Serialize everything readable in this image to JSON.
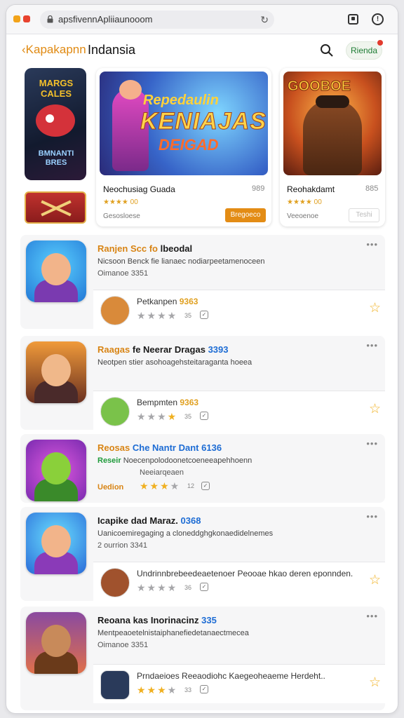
{
  "browser": {
    "address": "apsfivennApliiaunooom",
    "window_dot_colors": [
      "#f2a31a",
      "#e8432f"
    ]
  },
  "header": {
    "back_label": "Kapakapnn",
    "title": "Indansia",
    "pill_label": "Rienda"
  },
  "featured": {
    "side_cover_title": "MARGS CALES",
    "side_cover_subtitle": "BMNANTI BRES",
    "cards": [
      {
        "banner_lines": [
          "Repedaulin",
          "KENIAJAS",
          "DEIGAD"
        ],
        "title": "Neochusiag Guada",
        "count": "989",
        "rating": "★★★★ 00",
        "subtitle": "Gesosloese",
        "button": "Bregoeco"
      },
      {
        "banner_lines": [
          "GOOBOE"
        ],
        "title": "Reohakdamt",
        "count": "885",
        "rating": "★★★★ 00",
        "subtitle": "Veeoenoe",
        "button": "Teshi"
      }
    ]
  },
  "list": [
    {
      "name_lead": "Ranjen Scc fo",
      "name_dark": "lbeodal",
      "name_num": "",
      "desc": "Nicsoon Benck fie lianaec nodiarpeetamenoceen",
      "meta": "Oimanoe 3351",
      "sub_name": "Petkanpen",
      "sub_num": "9363",
      "stars_on": 0,
      "count": "35"
    },
    {
      "name_lead": "Raagas",
      "name_dark": "fe Neerar Dragas",
      "name_num": "3393",
      "desc": "Neotpen stier asohoagehsteitaraganta hoeea",
      "meta": "",
      "sub_name": "Bempmten",
      "sub_num": "9363",
      "stars_on": 1,
      "count": "35"
    },
    {
      "name_lead": "Reosas",
      "name_dark": "Che Nantr Dant",
      "name_num": "6136",
      "badge": "Reseir",
      "desc": "Noecenpolodoonetcoeneeapehhoenn",
      "meta": "Neeiarqeaen",
      "sub_name": "",
      "sub_num": "",
      "side_label": "Uedion",
      "stars_on": 2,
      "count": "12"
    },
    {
      "name_lead": "",
      "name_dark": "Icapike dad Maraz.",
      "name_num": "0368",
      "desc": "Uanicoemiregaging a cloneddghgkonaedidelnemes",
      "meta": "2 ourrion 3341",
      "sub_name": "Undrinnbrebeedeaetenoer Peooae hkao deren eponnden.",
      "sub_num": "",
      "stars_on": 0,
      "count": "36"
    },
    {
      "name_lead": "",
      "name_dark": "Reoana kas Inorinacinz",
      "name_num": "335",
      "desc": "Mentpeaoetelnistaiphanefiedetanaectmecea",
      "meta": "Oimanoe 3351",
      "sub_name": "Prndaeioes Reeaodiohc Kaegeoheaeme Herdeht..",
      "sub_num": "",
      "stars_on": 3,
      "count": "33"
    }
  ]
}
